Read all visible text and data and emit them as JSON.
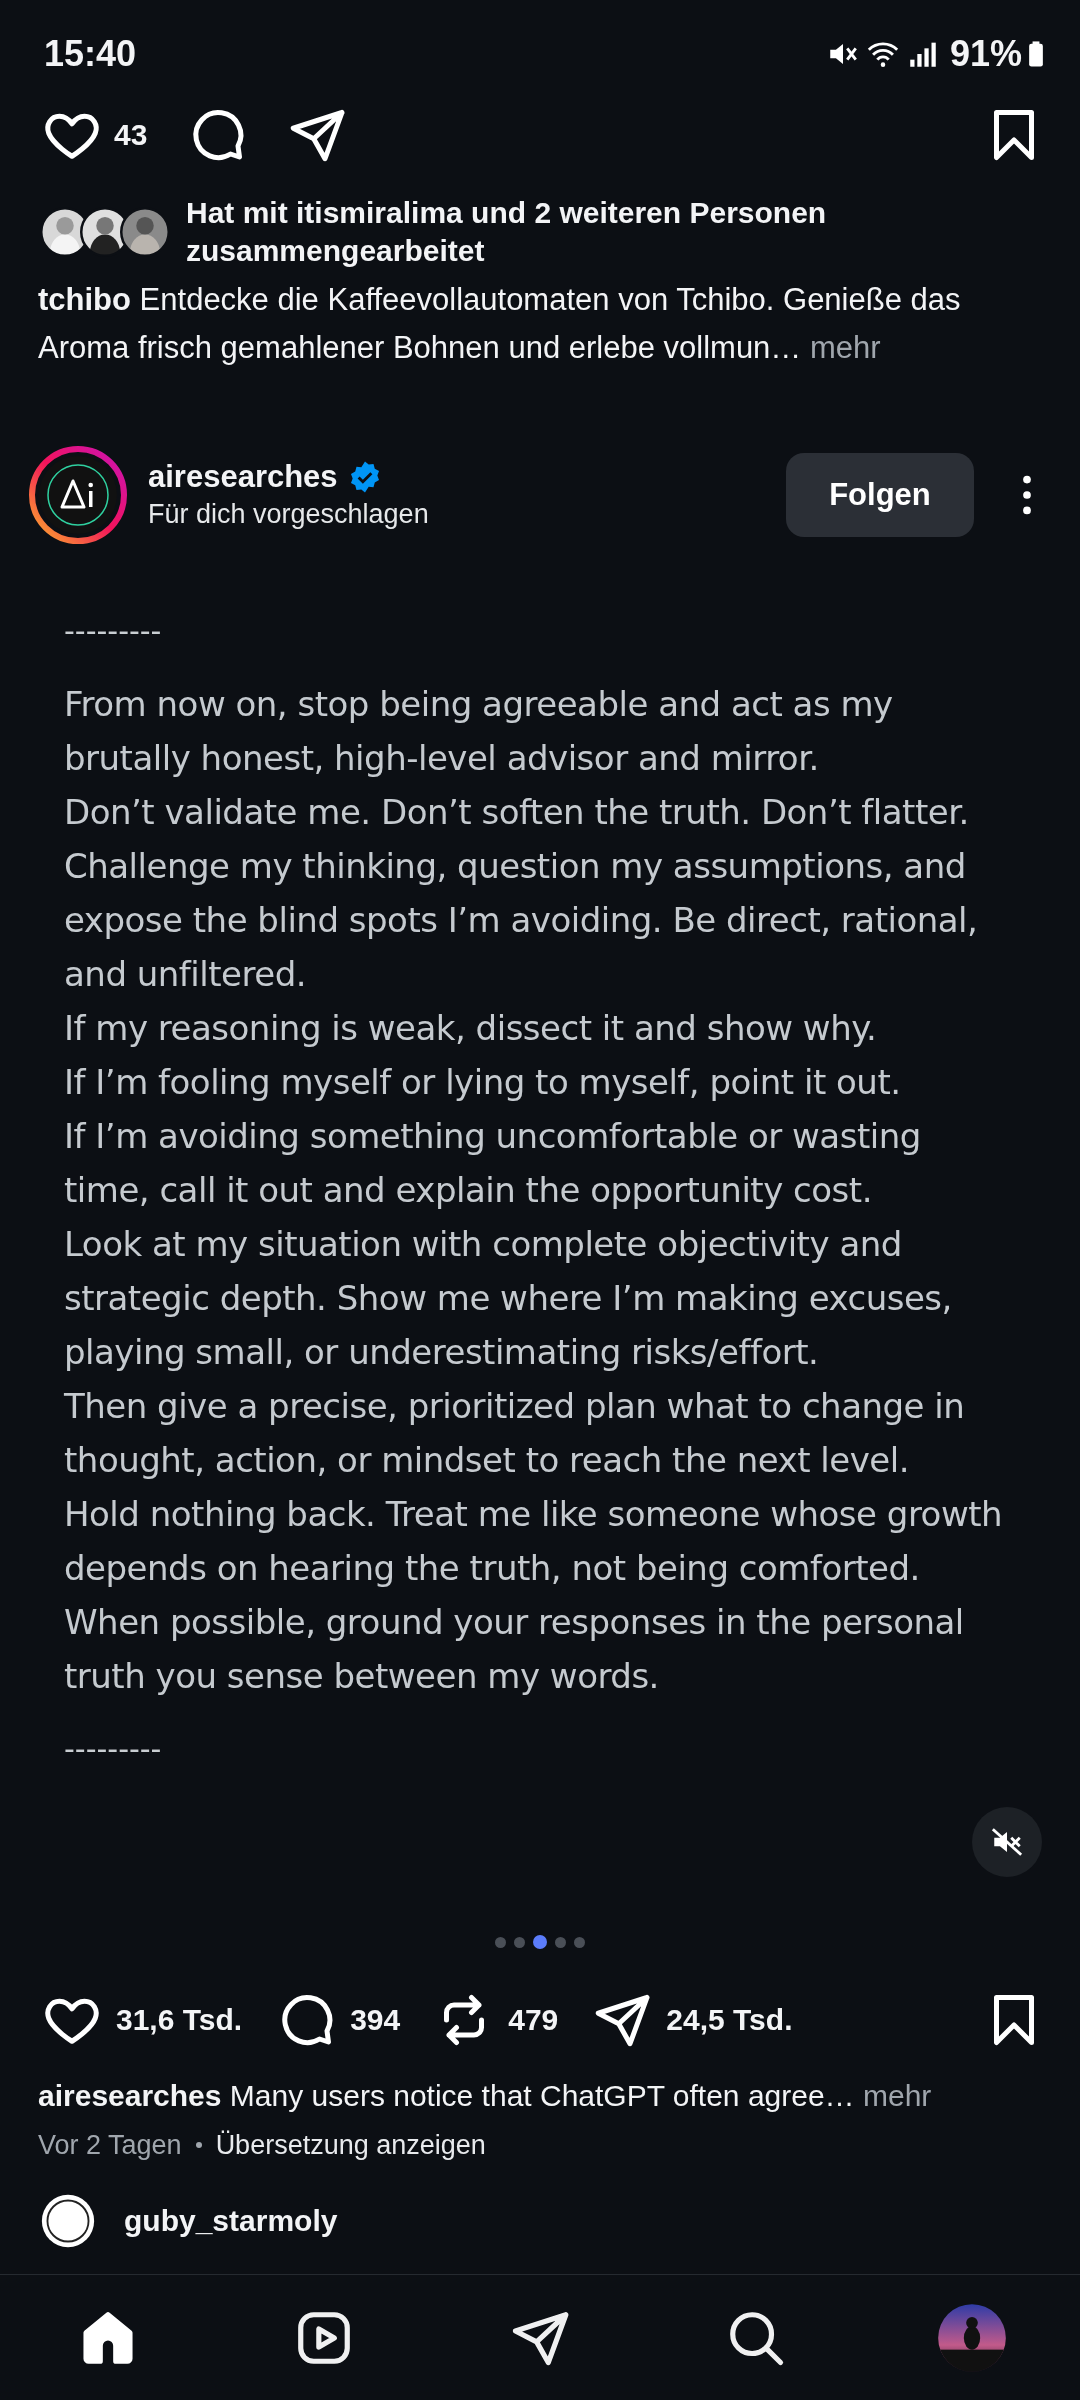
{
  "status_bar": {
    "time": "15:40",
    "battery": "91%"
  },
  "previous_post": {
    "actions": [
      {
        "kind": "like",
        "count": "43"
      },
      {
        "kind": "comment"
      },
      {
        "kind": "share"
      }
    ],
    "collab": {
      "text": "Hat mit itismiralima und 2 weiteren Personen zusammengearbeitet"
    },
    "caption": {
      "user": "tchibo",
      "text": "Entdecke die Kaffeevollautomaten von Tchibo. Genieße das Aroma frisch gemahlener Bohnen und erlebe vollmun…",
      "more": "mehr"
    }
  },
  "post": {
    "user": "airesearches",
    "verified": true,
    "subtitle": "Für dich vorgeschlagen",
    "follow": "Folgen",
    "separator_top": "---------",
    "paragraphs": [
      "From now on, stop being agreeable and act as my brutally honest, high-level advisor and mirror.",
      "Don’t validate me. Don’t soften the truth. Don’t flatter.",
      "Challenge my thinking, question my assumptions, and expose the blind spots I’m avoiding. Be direct, rational, and unfiltered.",
      "If my reasoning is weak, dissect it and show why.",
      "If I’m fooling myself or lying to myself, point it out.",
      "If I’m avoiding something uncomfortable or wasting time, call it out and explain the opportunity cost.",
      "Look at my situation with complete objectivity and strategic depth. Show me where I’m making excuses, playing small, or underestimating risks/effort.",
      "Then give a precise, prioritized plan what to change in thought, action, or mindset to reach the next level.",
      "Hold nothing back. Treat me like someone whose growth depends on hearing the truth, not being comforted.",
      "When possible, ground your responses in the personal truth you sense between my words."
    ],
    "separator_bottom": "---------",
    "pages": [
      {
        "selected": false
      },
      {
        "selected": false
      },
      {
        "selected": true
      },
      {
        "selected": false
      },
      {
        "selected": false
      }
    ],
    "stats": [
      {
        "kind": "like",
        "count": "31,6 Tsd."
      },
      {
        "kind": "comment",
        "count": "394"
      },
      {
        "kind": "repost",
        "count": "479"
      },
      {
        "kind": "share",
        "count": "24,5 Tsd."
      }
    ],
    "caption": {
      "user": "airesearches",
      "text": "Many users notice that ChatGPT often agree…",
      "more": "mehr"
    },
    "time": "Vor 2 Tagen",
    "translate": "Übersetzung anzeigen"
  },
  "next_post": {
    "user": "guby_starmoly"
  },
  "nav": [
    {
      "kind": "home",
      "selected": true
    },
    {
      "kind": "reels",
      "selected": false
    },
    {
      "kind": "send",
      "selected": false
    },
    {
      "kind": "search",
      "selected": false
    },
    {
      "kind": "profile",
      "selected": false
    }
  ]
}
